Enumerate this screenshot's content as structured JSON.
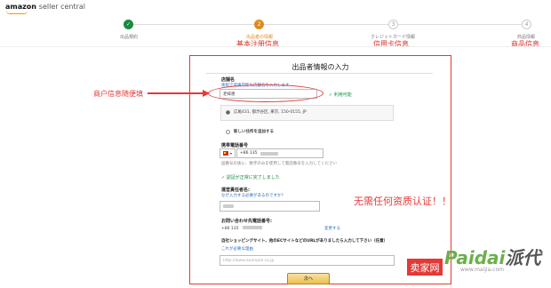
{
  "header": {
    "logo_brand": "amazon",
    "logo_suffix": "seller central"
  },
  "steps": [
    {
      "label": "出品規約",
      "status": "done",
      "number": "✓"
    },
    {
      "label": "出品者の情報",
      "status": "active",
      "number": "2",
      "annotation": "基本注册信息"
    },
    {
      "label": "クレジットカード情報",
      "status": "todo",
      "number": "3",
      "annotation": "信用卡信息"
    },
    {
      "label": "商品情報",
      "status": "todo",
      "number": "4",
      "annotation": "商品信息"
    }
  ],
  "form": {
    "title": "出品者情報の入力",
    "store_name": {
      "label": "店舗名",
      "help_link": "後程で変更可能な店舗名を入力します",
      "value": "老拝恵",
      "status": "利用可能"
    },
    "address": {
      "value": "広尾431, 都渋谷区, 東京, 150-0155, JP",
      "add_new": "新しい住所を追加する"
    },
    "phone": {
      "label": "携帯電話番号",
      "country_code": "+86",
      "value": "+86 135",
      "hint": "国番号の後に、数字のみを使用して電話番号を入力してください",
      "verified": "認証が正常に完了しました"
    },
    "responsible": {
      "label": "運営責任者名:",
      "help_link": "なぜ入力する必要があるのですか？"
    },
    "contact_phone": {
      "label": "お問い合わせ先電話番号:",
      "value": "+86 135",
      "change_link": "変更する"
    },
    "website": {
      "label": "自社ショッピングサイト、他のECサイトなどのURLがありましたら入力して下さい（任意）",
      "help_link": "これが必要な理由",
      "placeholder": "http://www.example.co.jp"
    },
    "next_button": "次へ"
  },
  "annotations": {
    "left_note": "商户信息随便填",
    "no_verification": "无需任何资质认证！！"
  },
  "watermark": {
    "tag": "卖家网",
    "logo_a": "Paidai",
    "logo_b": "派代",
    "url": "www.maijia.com"
  },
  "colors": {
    "annotation": "#e53935",
    "success": "#1a8a3f",
    "active_step": "#e08a1e",
    "link": "#2a6ebb"
  }
}
